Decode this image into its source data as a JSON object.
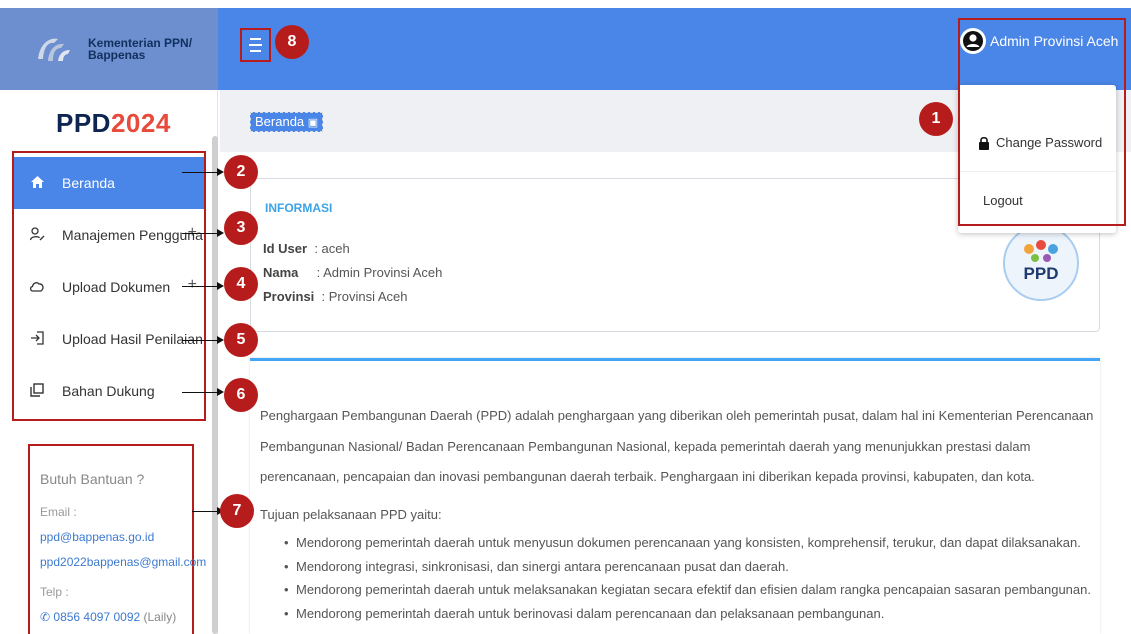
{
  "brand": {
    "line1": "Kementerian PPN/",
    "line2": "Bappenas",
    "logo_icon": "bappenas-logo-icon"
  },
  "header": {
    "menu_icon": "hamburger-icon",
    "user_name": "Admin Provinsi Aceh",
    "user_icon": "user-avatar-icon"
  },
  "user_dropdown": {
    "change_password": "Change Password",
    "logout": "Logout",
    "lock_icon": "lock-icon"
  },
  "sidebar": {
    "title_prefix": "PPD",
    "title_year": "2024",
    "items": [
      {
        "label": "Beranda",
        "icon": "home-icon",
        "active": true
      },
      {
        "label": "Manajemen Pengguna",
        "icon": "user-edit-icon",
        "plus": "+"
      },
      {
        "label": "Upload Dokumen",
        "icon": "cloud-icon",
        "plus": "+"
      },
      {
        "label": "Upload Hasil Penilaian",
        "icon": "sign-in-icon"
      },
      {
        "label": "Bahan Dukung",
        "icon": "copy-icon"
      }
    ]
  },
  "help": {
    "title": "Butuh Bantuan ?",
    "email_label": "Email :",
    "emails": [
      "ppd@bappenas.go.id",
      "ppd2022bappenas@gmail.com"
    ],
    "phone_label": "Telp :",
    "phone": "0856 4097 0092",
    "phone_name": "(Laily)"
  },
  "breadcrumb": {
    "label": "Beranda"
  },
  "info": {
    "title": "INFORMASI",
    "id_label": "Id User",
    "id_value": ": aceh",
    "name_label": "Nama",
    "name_value": ": Admin Provinsi Aceh",
    "province_label": "Provinsi",
    "province_value": ": Provinsi Aceh",
    "logo_text": "PPD"
  },
  "description": {
    "paragraph": "Penghargaan Pembangunan Daerah (PPD) adalah penghargaan yang diberikan oleh pemerintah pusat, dalam hal ini Kementerian Perencanaan Pembangunan Nasional/ Badan Perencanaan Pembangunan Nasional, kepada pemerintah daerah yang menunjukkan prestasi dalam perencanaan, pencapaian dan inovasi pembangunan daerah terbaik. Penghargaan ini diberikan kepada provinsi, kabupaten, dan kota.",
    "goals_title": "Tujuan pelaksanaan PPD yaitu:",
    "goals": [
      "Mendorong pemerintah daerah untuk menyusun dokumen perencanaan yang konsisten, komprehensif, terukur, dan dapat dilaksanakan.",
      "Mendorong integrasi, sinkronisasi, dan sinergi antara perencanaan pusat dan daerah.",
      "Mendorong pemerintah daerah untuk melaksanakan kegiatan secara efektif dan efisien dalam rangka pencapaian sasaran pembangunan.",
      "Mendorong pemerintah daerah untuk berinovasi dalam perencanaan dan pelaksanaan pembangunan."
    ]
  },
  "annotations": [
    "1",
    "2",
    "3",
    "4",
    "5",
    "6",
    "7",
    "8"
  ],
  "colors": {
    "primary": "#4a86e8",
    "annotation": "#b71c1c",
    "info_title": "#3aa3e8"
  }
}
